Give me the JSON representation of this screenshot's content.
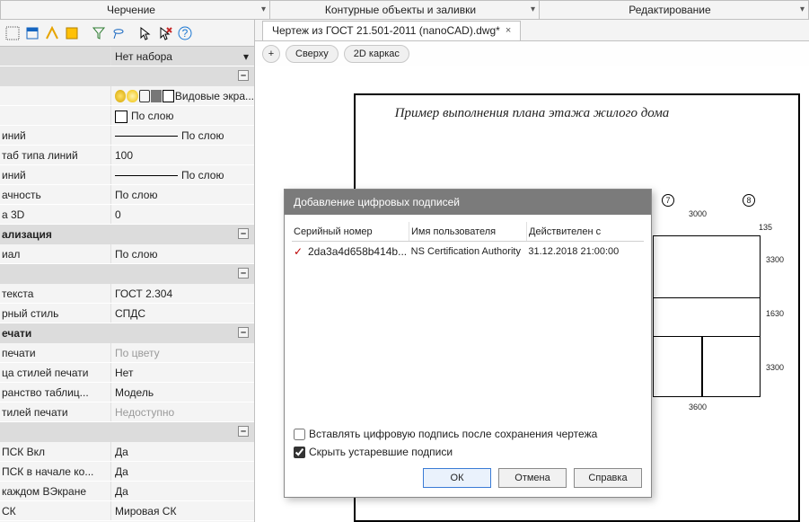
{
  "ribbon": {
    "t0": "Черчение",
    "t1": "Контурные объекты и заливки",
    "t2": "Редактирование",
    "exp": "▾"
  },
  "tools": {
    "i0": "select-similar-icon",
    "i1": "select-window-icon",
    "i2": "match-props-icon",
    "i3": "select-by-color-icon",
    "i4": "filter-icon",
    "i5": "lasso-icon",
    "i6": "cursor-icon",
    "i7": "cancel-icon",
    "i8": "help-icon"
  },
  "header": {
    "label": "",
    "value": "Нет набора"
  },
  "sections": {
    "general": "",
    "vis": "ализация",
    "text": "",
    "print": "ечати",
    "cs": "",
    "minus": "–"
  },
  "props": {
    "layer_controls": "Видовые экра...",
    "color_label": "",
    "color_value": "По слою",
    "ltype_label": "иний",
    "ltype_value": "По слою",
    "ltscale_label": "таб типа линий",
    "ltscale_value": "100",
    "lweight_label": "иний",
    "lweight_value": "По слою",
    "transp_label": "ачность",
    "transp_value": "По слою",
    "h3d_label": "а 3D",
    "h3d_value": "0",
    "mat_label": "иал",
    "mat_value": "По слою",
    "tstyle_label": "текста",
    "tstyle_value": "ГОСТ 2.304",
    "dstyle_label": "рный стиль",
    "dstyle_value": "СПДС",
    "pstyle_label": "печати",
    "pstyle_value": "По цвету",
    "ptbl_label": "ца стилей печати",
    "ptbl_value": "Нет",
    "pspc_label": "ранство таблиц...",
    "pspc_value": "Модель",
    "pst_label": "тилей печати",
    "pst_value": "Недоступно",
    "ucs_on_label": "ПСК Вкл",
    "ucs_on_value": "Да",
    "ucs_origin_label": "ПСК в начале ко...",
    "ucs_origin_value": "Да",
    "ucs_vp_label": "каждом ВЭкране",
    "ucs_vp_value": "Да",
    "ucs_name_label": "СК",
    "ucs_name_value": "Мировая СК"
  },
  "doc": {
    "title": "Чертеж из ГОСТ 21.501-2011 (nanoCAD).dwg*",
    "close": "×"
  },
  "chips": {
    "plus": "+",
    "top": "Сверху",
    "wire": "2D каркас"
  },
  "drawing": {
    "title": "Пример выполнения плана этажа жилого дома",
    "b0": "7",
    "b1": "8",
    "d0": "3000",
    "d1": "135",
    "d2": "3300",
    "d3": "1630",
    "d4": "3300",
    "d5": "3600"
  },
  "dialog": {
    "title": "Добавление цифровых подписей",
    "c0": "Серийный номер",
    "c1": "Имя пользователя",
    "c2": "Действителен с",
    "serial": "2da3a4d658b414b...",
    "user": "NS Certification Authority",
    "valid": "31.12.2018 21:00:00",
    "opt1": "Вставлять цифровую подпись после сохранения чертежа",
    "opt2": "Скрыть устаревшие подписи",
    "ok": "ОК",
    "cancel": "Отмена",
    "help": "Справка",
    "check": "✓"
  }
}
